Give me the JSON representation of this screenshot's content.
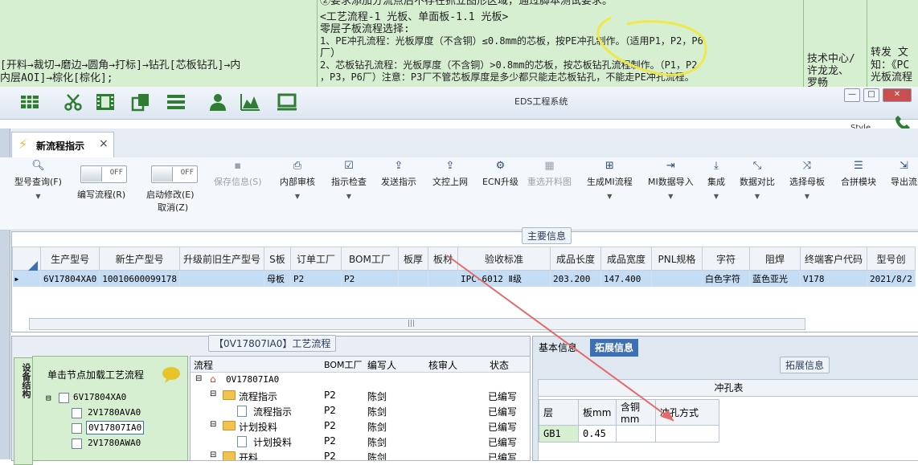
{
  "background_doc": {
    "top_line": "②要求添加分流点后不存在抓立图形区域，通过脚本测试要求。",
    "left_col": [
      "[开料→裁切→磨边→圆角→打标]→钻孔[芯板钻孔]→内",
      "内层AOI]→棕化[棕化];"
    ],
    "mid_col": [
      "<工艺流程-1 光板、单面板-1.1 光板>",
      "零层子板流程选择:",
      "1、PE冲孔流程：光板厚度（不含铜）≤0.8mm的芯板，按PE冲孔制作。（适用P1，P2，P6",
      "厂）",
      "2、芯板钻孔流程：光板厚度（不含铜）>0.8mm的芯板，按芯板钻孔流程制作。（P1，P2",
      "，P3，P6厂）注意：P3厂不管芯板厚度是多少都只能走芯板钻孔，不能走PE冲孔流程。"
    ],
    "col3": [
      "技术中心/",
      "许龙龙、",
      "罗畅"
    ],
    "col4": [
      "转发  文",
      "知：《PC",
      "光板流程"
    ]
  },
  "window": {
    "title": "EDS工程系统",
    "style_label": "Style",
    "minimize": "—",
    "restore": "□",
    "close": "✕"
  },
  "main_toolbar": {
    "icons": [
      "table-icon",
      "scissors-icon",
      "film-icon",
      "copy-icon",
      "list-icon",
      "user-icon",
      "chart-icon",
      "monitor-icon"
    ]
  },
  "tab": {
    "label": "新流程指示",
    "close": "×"
  },
  "ribbon": {
    "model_query": "型号查询(F)",
    "edit_flow": "编写流程(R)",
    "enable_modify": "启动修改(E)",
    "cancel": "取消(Z)",
    "toggle_off": "OFF",
    "save_info": "保存信息(S)",
    "internal_review": "内部审核",
    "instruction_check": "指示检查",
    "send_instruction": "发送指示",
    "text_upload": "文控上网",
    "ecn_upgrade": "ECN升级",
    "reopen_chart": "重选开料图",
    "gen_mi_flow": "生成MI流程",
    "mi_import": "MI数据导入",
    "integrate": "集成",
    "data_compare": "数据对比",
    "select_mother": "选择母板",
    "merge_module": "合拼模块",
    "export_flow": "导出流"
  },
  "main_info": {
    "section_label": "主要信息",
    "columns": [
      "生产型号",
      "新生产型号",
      "升级前旧生产型号",
      "S板",
      "订单工厂",
      "BOM工厂",
      "板厚",
      "板材",
      "验收标准",
      "成品长度",
      "成品宽度",
      "PNL规格",
      "字符",
      "阻焊",
      "终端客户代码",
      "型号创"
    ],
    "row": {
      "prod_model": "6V17804XA0",
      "new_model": "10010600099178",
      "old_model": "",
      "s_board": "母板",
      "order_factory": "P2",
      "bom_factory": "P2",
      "thickness": "",
      "material": "",
      "standard": "IPC-6012 Ⅱ级",
      "length": "203.200",
      "width": "147.400",
      "pnl": "",
      "char": "白色字符",
      "solder": "蓝色亚光",
      "customer": "V178",
      "created": "2021/8/2"
    }
  },
  "process": {
    "section_label": "【0V17807IA0】工艺流程",
    "side_tab": "设备结构",
    "tree_hint": "单击节点加载工艺流程",
    "tree": [
      "6V17804XA0",
      "2V1780AVA0",
      "0V17807IA0",
      "2V1780AWA0"
    ],
    "flow_headers": [
      "流程",
      "BOM工厂",
      "编写人",
      "核审人",
      "状态"
    ],
    "flow_rows": [
      {
        "name": "0V17807IA0",
        "factory": "",
        "writer": "",
        "reviewer": "",
        "status": ""
      },
      {
        "name": "流程指示",
        "factory": "P2",
        "writer": "陈剑",
        "reviewer": "",
        "status": "已编写"
      },
      {
        "name": "流程指示",
        "factory": "P2",
        "writer": "陈剑",
        "reviewer": "",
        "status": "已编写"
      },
      {
        "name": "计划投料",
        "factory": "P2",
        "writer": "陈剑",
        "reviewer": "",
        "status": "已编写"
      },
      {
        "name": "计划投料",
        "factory": "P2",
        "writer": "陈剑",
        "reviewer": "",
        "status": "已编写"
      },
      {
        "name": "开料",
        "factory": "P2",
        "writer": "陈剑",
        "reviewer": "",
        "status": "已编写"
      }
    ]
  },
  "right_panel": {
    "tab_basic": "基本信息",
    "tab_ext": "拓展信息",
    "ext_label": "拓展信息",
    "table_title": "冲孔表",
    "headers": [
      "层",
      "板mm",
      "含铜mm",
      "冲孔方式"
    ],
    "row": [
      "GB1",
      "0.45",
      "",
      ""
    ]
  },
  "colors": {
    "selection": "#c5ddf4",
    "tab_active": "#3d6fb5",
    "annotation": "#f0e84a",
    "arrow": "#e36a6a"
  }
}
